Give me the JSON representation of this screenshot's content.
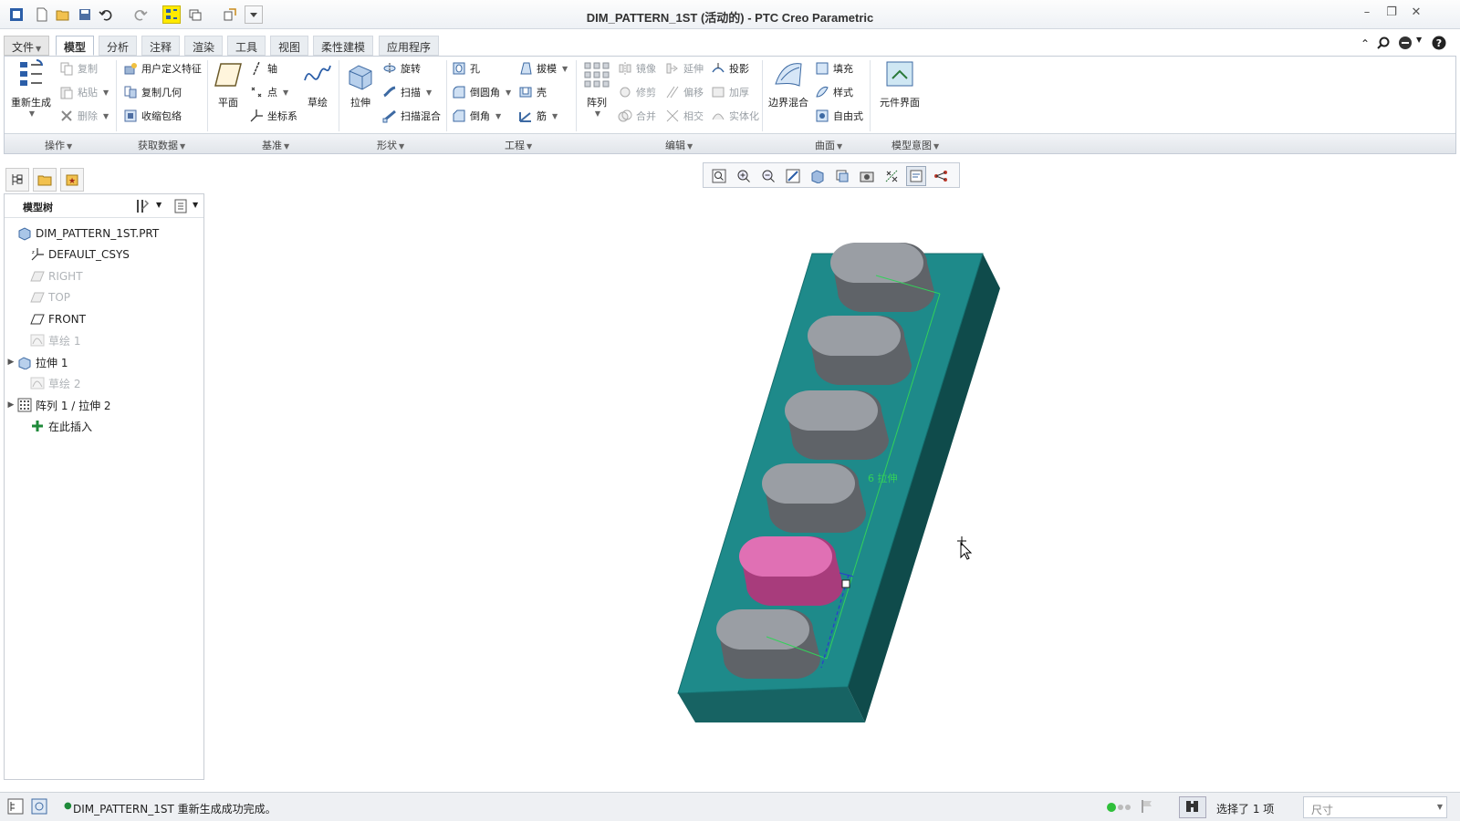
{
  "window": {
    "title": "DIM_PATTERN_1ST (活动的) - PTC Creo Parametric",
    "controls": [
      "minimize-icon",
      "restore-icon",
      "close-icon"
    ]
  },
  "tabs": [
    "文件",
    "模型",
    "分析",
    "注释",
    "渲染",
    "工具",
    "视图",
    "柔性建模",
    "应用程序"
  ],
  "active_tab": "模型",
  "ribbon": {
    "operations": {
      "regenerate": "重新生成",
      "copy": "复制",
      "paste": "粘贴",
      "delete": "删除",
      "label": "操作"
    },
    "get_data": {
      "udf": "用户定义特征",
      "copy_geom": "复制几何",
      "shrinkwrap": "收缩包络",
      "label": "获取数据"
    },
    "datum": {
      "plane": "平面",
      "axis": "轴",
      "point": "点",
      "csys": "坐标系",
      "sketch": "草绘",
      "label": "基准"
    },
    "shapes": {
      "extrude": "拉伸",
      "revolve": "旋转",
      "sweep": "扫描",
      "swept_blend": "扫描混合",
      "label": "形状"
    },
    "engineering": {
      "hole": "孔",
      "draft": "拔模",
      "round": "倒圆角",
      "shell": "壳",
      "chamfer": "倒角",
      "rib": "筋",
      "label": "工程"
    },
    "editing": {
      "pattern": "阵列",
      "mirror": "镜像",
      "extend": "延伸",
      "project": "投影",
      "trim": "修剪",
      "offset": "偏移",
      "thicken": "加厚",
      "merge": "合并",
      "intersect": "相交",
      "solidify": "实体化",
      "label": "编辑"
    },
    "surfaces": {
      "boundary_blend": "边界混合",
      "fill": "填充",
      "style": "样式",
      "freestyle": "自由式",
      "label": "曲面"
    },
    "model_intent": {
      "component_interface": "元件界面",
      "label": "模型意图"
    }
  },
  "model_tree": {
    "header": "模型树",
    "items": [
      {
        "label": "DIM_PATTERN_1ST.PRT",
        "icon": "part-icon",
        "dim": false,
        "expandable": false
      },
      {
        "label": "DEFAULT_CSYS",
        "icon": "csys-icon",
        "dim": false,
        "expandable": false
      },
      {
        "label": "RIGHT",
        "icon": "datum-plane-icon",
        "dim": true,
        "expandable": false
      },
      {
        "label": "TOP",
        "icon": "datum-plane-icon",
        "dim": true,
        "expandable": false
      },
      {
        "label": "FRONT",
        "icon": "datum-plane-icon",
        "dim": false,
        "expandable": false
      },
      {
        "label": "草绘 1",
        "icon": "sketch-icon",
        "dim": true,
        "expandable": false
      },
      {
        "label": "拉伸 1",
        "icon": "extrude-icon",
        "dim": false,
        "expandable": true
      },
      {
        "label": "草绘 2",
        "icon": "sketch-icon",
        "dim": true,
        "expandable": false
      },
      {
        "label": "阵列 1 / 拉伸 2",
        "icon": "pattern-icon",
        "dim": false,
        "expandable": true
      },
      {
        "label": "在此插入",
        "icon": "insert-here-icon",
        "dim": false,
        "expandable": false
      }
    ]
  },
  "graphics": {
    "dimension_label": "6 拉伸",
    "colors": {
      "base": "#1e8a8a",
      "boss": "#9a9ea4",
      "selected": "#e070b4",
      "dimension": "#33d15a"
    }
  },
  "status": {
    "message": "DIM_PATTERN_1ST 重新生成成功完成。",
    "selection": "选择了 1 项",
    "filter_value": "尺寸"
  }
}
